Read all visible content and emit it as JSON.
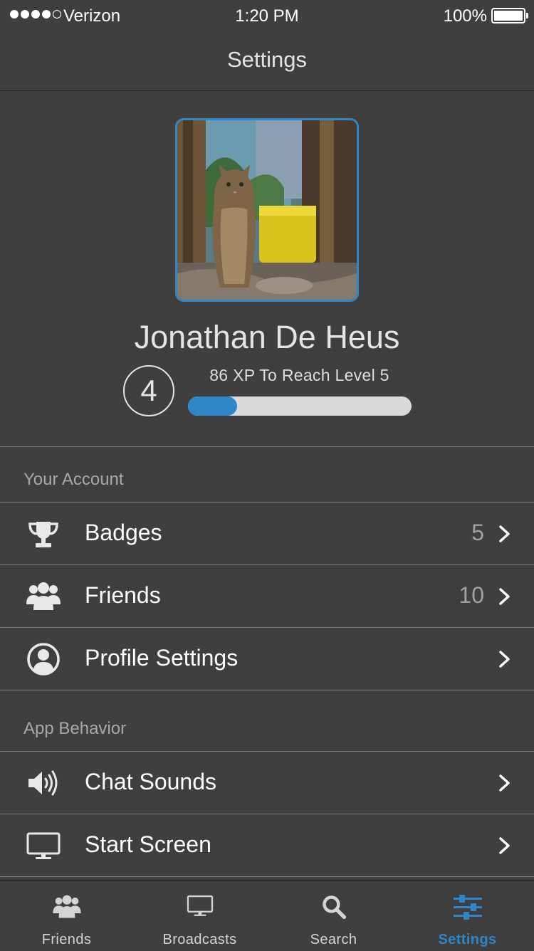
{
  "status_bar": {
    "carrier": "Verizon",
    "time": "1:20 PM",
    "battery": "100%",
    "signal_bars_filled": 4,
    "signal_bars_total": 5
  },
  "nav": {
    "title": "Settings"
  },
  "profile": {
    "name": "Jonathan De Heus",
    "level": "4",
    "xp_text": "86 XP To Reach Level 5",
    "xp_progress_fraction": 0.22
  },
  "sections": [
    {
      "header": "Your Account",
      "rows": [
        {
          "label": "Badges",
          "value": "5",
          "icon": "trophy-icon"
        },
        {
          "label": "Friends",
          "value": "10",
          "icon": "users-icon"
        },
        {
          "label": "Profile Settings",
          "value": "",
          "icon": "user-circle-icon"
        }
      ]
    },
    {
      "header": "App Behavior",
      "rows": [
        {
          "label": "Chat Sounds",
          "value": "",
          "icon": "speaker-icon"
        },
        {
          "label": "Start Screen",
          "value": "",
          "icon": "monitor-icon"
        }
      ]
    }
  ],
  "tabbar": {
    "tabs": [
      {
        "label": "Friends",
        "icon": "users-icon",
        "active": false
      },
      {
        "label": "Broadcasts",
        "icon": "monitor-icon",
        "active": false
      },
      {
        "label": "Search",
        "icon": "search-icon",
        "active": false
      },
      {
        "label": "Settings",
        "icon": "sliders-icon",
        "active": true
      }
    ]
  },
  "colors": {
    "background": "#3f3f3f",
    "accent": "#2f86c8",
    "divider": "#7c7c7c",
    "secondary_text": "#a8a8a8"
  }
}
